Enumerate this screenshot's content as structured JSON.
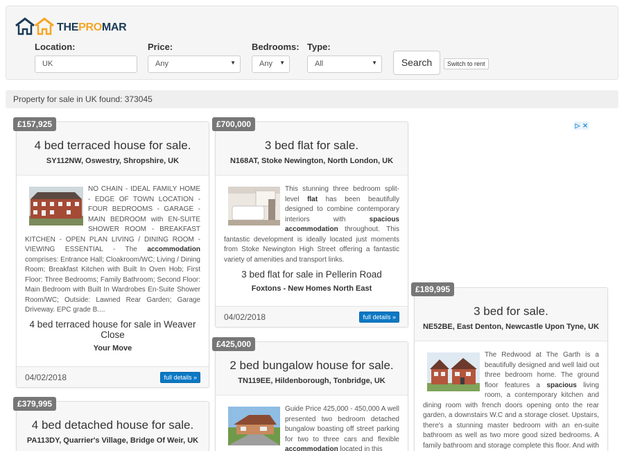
{
  "brand": {
    "logo_text_1": "THE",
    "logo_text_2": "PRO",
    "logo_text_3": "MAR"
  },
  "filters": {
    "location_label": "Location:",
    "location_value": "UK",
    "price_label": "Price:",
    "price_value": "Any",
    "bedrooms_label": "Bedrooms:",
    "bedrooms_value": "Any",
    "type_label": "Type:",
    "type_value": "All",
    "search_label": "Search",
    "switch_label": "Switch to rent"
  },
  "results": {
    "summary": "Property for sale in UK found: 373045"
  },
  "listings": [
    {
      "price": "£157,925",
      "title": "4 bed terraced house for sale.",
      "address": "SY112NW, Oswestry, Shropshire, UK",
      "desc_a": "NO CHAIN - IDEAL FAMILY HOME - EDGE OF TOWN LOCATION - FOUR BEDROOMS - GARAGE - MAIN BEDROOM with EN-SUITE SHOWER ROOM - BREAKFAST KITCHEN - OPEN PLAN LIVING / DINING ROOM - VIEWING ESSENTIAL - The ",
      "desc_b": "accommodation",
      "desc_c": " comprises: Entrance Hall; Cloakroom/WC; Living / Dining Room; Breakfast Kitchen with Built In Oven Hob; First Floor: Three Bedrooms; Family Bathroom; Second Floor: Main Bedroom with Built In Wardrobes En-Suite Shower Room/WC; Outside: Lawned Rear Garden; Garage Driveway. EPC grade B....",
      "subtitle": "4 bed terraced house for sale in Weaver Close",
      "agent": "Your Move",
      "date": "04/02/2018",
      "details_label": "full details »"
    },
    {
      "price": "£700,000",
      "title": "3 bed flat for sale.",
      "address": "N168AT, Stoke Newington, North London, UK",
      "desc_a": "This stunning three bedroom split-level ",
      "desc_b": "flat",
      "desc_c": " has been beautifully designed to combine contemporary interiors with ",
      "desc_d": "spacious accommodation",
      "desc_e": " throughout. This fantastic development is ideally located just moments from Stoke Newington High Street offering a fantastic variety of amenities and transport links.",
      "subtitle": "3 bed flat for sale in Pellerin Road",
      "agent": "Foxtons - New Homes North East",
      "date": "04/02/2018",
      "details_label": "full details »"
    },
    {
      "price": "£425,000",
      "title": "2 bed bungalow house for sale.",
      "address": "TN119EE, Hildenborough, Tonbridge, UK",
      "desc_a": "Guide Price 425,000 - 450,000 A well presented two bedroom detached bungalow boasting off street parking for two to three cars and flexible ",
      "desc_b": "accommodation",
      "desc_c": " located in this"
    },
    {
      "price": "£379,995",
      "title": "4 bed detached house for sale.",
      "address": "PA113DY, Quarrier's Village, Bridge Of Weir, UK"
    },
    {
      "price": "£189,995",
      "title": "3 bed for sale.",
      "address": "NE52BE, East Denton, Newcastle Upon Tyne, UK",
      "desc_a": "The Redwood at The Garth is a beautifully designed and well laid out three bedroom home. The ground floor features a ",
      "desc_b": "spacious",
      "desc_c": " living room, a contemporary kitchen and dining room with french doors opening onto the rear garden, a downstairs W.C and a storage closet. Upstairs, there's a stunning master bedroom with an en-suite bathroom as well as two more good sized bedrooms. A family bathroom and storage complete this floor. And with Help"
    }
  ],
  "colors": {
    "badge": "#777777",
    "details_button": "#0b78c4",
    "logo_dark": "#1c3a57",
    "logo_accent": "#f5a623"
  },
  "icons": [
    "house-logo-icon",
    "dropdown-caret-icon",
    "adchoices-icon"
  ]
}
